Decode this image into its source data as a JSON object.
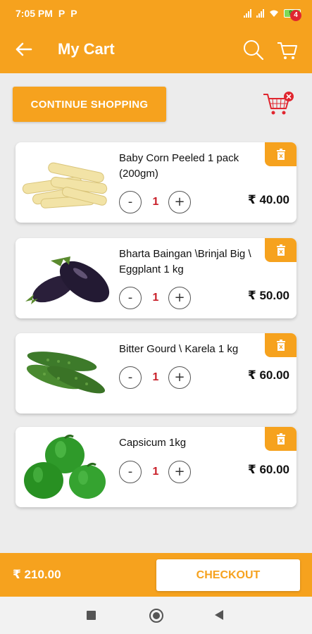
{
  "status_bar": {
    "time": "7:05 PM",
    "icons": [
      "p-icon",
      "p-icon"
    ],
    "battery": "99"
  },
  "app_bar": {
    "title": "My Cart",
    "cart_count": "4"
  },
  "continue_label": "CONTINUE SHOPPING",
  "items": [
    {
      "name": "Baby Corn Peeled 1 pack (200gm)",
      "qty": "1",
      "price": "₹ 40.00",
      "minus": "-",
      "plus": "+"
    },
    {
      "name": "Bharta Baingan \\Brinjal Big \\ Eggplant 1 kg",
      "qty": "1",
      "price": "₹ 50.00",
      "minus": "-",
      "plus": "+"
    },
    {
      "name": "Bitter Gourd \\ Karela 1 kg",
      "qty": "1",
      "price": "₹ 60.00",
      "minus": "-",
      "plus": "+"
    },
    {
      "name": "Capsicum 1kg",
      "qty": "1",
      "price": "₹ 60.00",
      "minus": "-",
      "plus": "+"
    }
  ],
  "footer": {
    "total": "₹ 210.00",
    "checkout_label": "CHECKOUT"
  },
  "colors": {
    "accent": "#f6a21e",
    "qty": "#c9202a",
    "badge": "#e0262f"
  }
}
